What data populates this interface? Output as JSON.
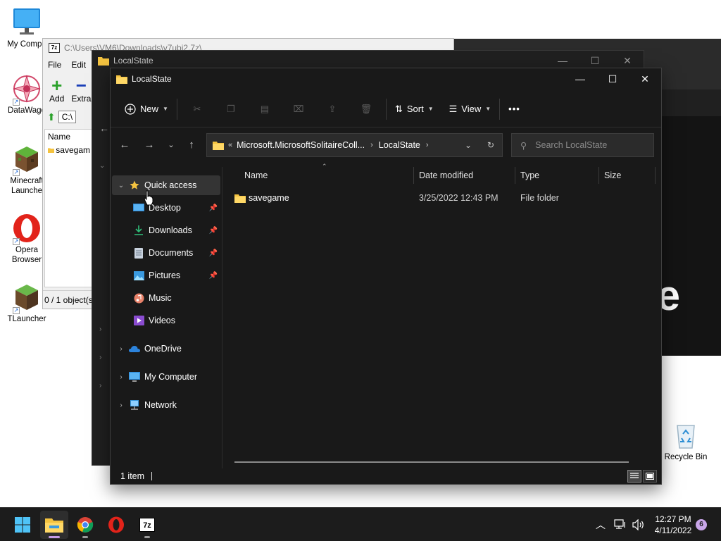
{
  "desktop": {
    "icons": [
      {
        "label": "My Compu",
        "icon": "monitor-icon"
      },
      {
        "label": "DataWago",
        "icon": "datawagon-icon"
      },
      {
        "label": "Minecraft Launche",
        "icon": "minecraft-icon"
      },
      {
        "label": "Opera Browser",
        "icon": "opera-icon"
      },
      {
        "label": "TLauncher",
        "icon": "tlauncher-icon"
      },
      {
        "label": "Recycle Bin",
        "icon": "recycle-bin-icon"
      }
    ]
  },
  "zip_window": {
    "title": "C:\\Users\\VM6\\Downloads\\v7ubi2.7z\\",
    "menu": [
      "File",
      "Edit"
    ],
    "toolbar": {
      "add": "Add",
      "extract": "Extra"
    },
    "path_box": "C:\\",
    "list_header": "Name",
    "list_item": "savegam",
    "status": "0 / 1 object(s"
  },
  "mid_window": {
    "title": "LocalState"
  },
  "explorer": {
    "title": "LocalState",
    "commands": {
      "new": "New",
      "sort": "Sort",
      "view": "View",
      "more": "•••"
    },
    "address": {
      "prefix": "«",
      "crumbs": [
        "Microsoft.MicrosoftSolitaireColl...",
        "LocalState"
      ]
    },
    "search_placeholder": "Search LocalState",
    "nav": {
      "quick_access": "Quick access",
      "pinned": [
        "Desktop",
        "Downloads",
        "Documents",
        "Pictures"
      ],
      "others": [
        "Music",
        "Videos"
      ],
      "onedrive": "OneDrive",
      "my_computer": "My Computer",
      "network": "Network"
    },
    "columns": [
      "Name",
      "Date modified",
      "Type",
      "Size"
    ],
    "rows": [
      {
        "name": "savegame",
        "date": "3/25/2022 12:43 PM",
        "type": "File folder",
        "size": ""
      }
    ],
    "status": "1 item"
  },
  "taskbar": {
    "time": "12:27 PM",
    "date": "4/11/2022",
    "notifications": "6"
  },
  "colors": {
    "folder": "#f4c340",
    "accent": "#c59be6",
    "background": "#191919"
  }
}
